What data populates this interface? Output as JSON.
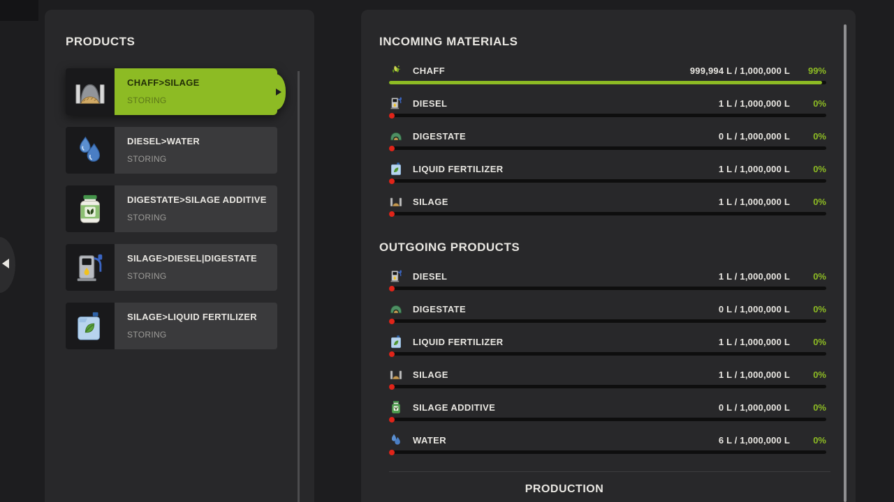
{
  "colors": {
    "background": "#1d1d1f",
    "panel": "#28282a",
    "accent_green": "#8dbb24",
    "alert_red": "#e02419",
    "text_primary": "#e9e7e2",
    "text_secondary": "#9d9c99"
  },
  "nav": {
    "back_arrow_icon": "chevron-left-icon"
  },
  "products_panel": {
    "title": "PRODUCTS",
    "items": [
      {
        "name": "CHAFF>SILAGE",
        "status": "STORING",
        "icon": "bunker-silo-icon",
        "selected": true
      },
      {
        "name": "DIESEL>WATER",
        "status": "STORING",
        "icon": "water-drops-icon",
        "selected": false
      },
      {
        "name": "DIGESTATE>SILAGE ADDITIVE",
        "status": "STORING",
        "icon": "additive-jar-icon",
        "selected": false
      },
      {
        "name": "SILAGE>DIESEL|DIGESTATE",
        "status": "STORING",
        "icon": "fuel-pump-icon",
        "selected": false
      },
      {
        "name": "SILAGE>LIQUID FERTILIZER",
        "status": "STORING",
        "icon": "fertilizer-canister-icon",
        "selected": false
      }
    ]
  },
  "details_panel": {
    "incoming": {
      "title": "INCOMING MATERIALS",
      "rows": [
        {
          "label": "CHAFF",
          "amount": "999,994 L / 1,000,000 L",
          "percent": "99%",
          "fill": 99,
          "icon": "chaff-icon"
        },
        {
          "label": "DIESEL",
          "amount": "1 L / 1,000,000 L",
          "percent": "0%",
          "fill": 0,
          "icon": "diesel-pump-icon"
        },
        {
          "label": "DIGESTATE",
          "amount": "0 L / 1,000,000 L",
          "percent": "0%",
          "fill": 0,
          "icon": "digestate-icon"
        },
        {
          "label": "LIQUID FERTILIZER",
          "amount": "1 L / 1,000,000 L",
          "percent": "0%",
          "fill": 0,
          "icon": "liquid-fertilizer-icon"
        },
        {
          "label": "SILAGE",
          "amount": "1 L / 1,000,000 L",
          "percent": "0%",
          "fill": 0,
          "icon": "silage-icon"
        }
      ]
    },
    "outgoing": {
      "title": "OUTGOING PRODUCTS",
      "rows": [
        {
          "label": "DIESEL",
          "amount": "1 L / 1,000,000 L",
          "percent": "0%",
          "fill": 0,
          "icon": "diesel-pump-icon"
        },
        {
          "label": "DIGESTATE",
          "amount": "0 L / 1,000,000 L",
          "percent": "0%",
          "fill": 0,
          "icon": "digestate-icon"
        },
        {
          "label": "LIQUID FERTILIZER",
          "amount": "1 L / 1,000,000 L",
          "percent": "0%",
          "fill": 0,
          "icon": "liquid-fertilizer-icon"
        },
        {
          "label": "SILAGE",
          "amount": "1 L / 1,000,000 L",
          "percent": "0%",
          "fill": 0,
          "icon": "silage-icon"
        },
        {
          "label": "SILAGE ADDITIVE",
          "amount": "0 L / 1,000,000 L",
          "percent": "0%",
          "fill": 0,
          "icon": "silage-additive-icon"
        },
        {
          "label": "WATER",
          "amount": "6 L / 1,000,000 L",
          "percent": "0%",
          "fill": 0,
          "icon": "water-icon"
        }
      ]
    },
    "production_title": "PRODUCTION"
  }
}
